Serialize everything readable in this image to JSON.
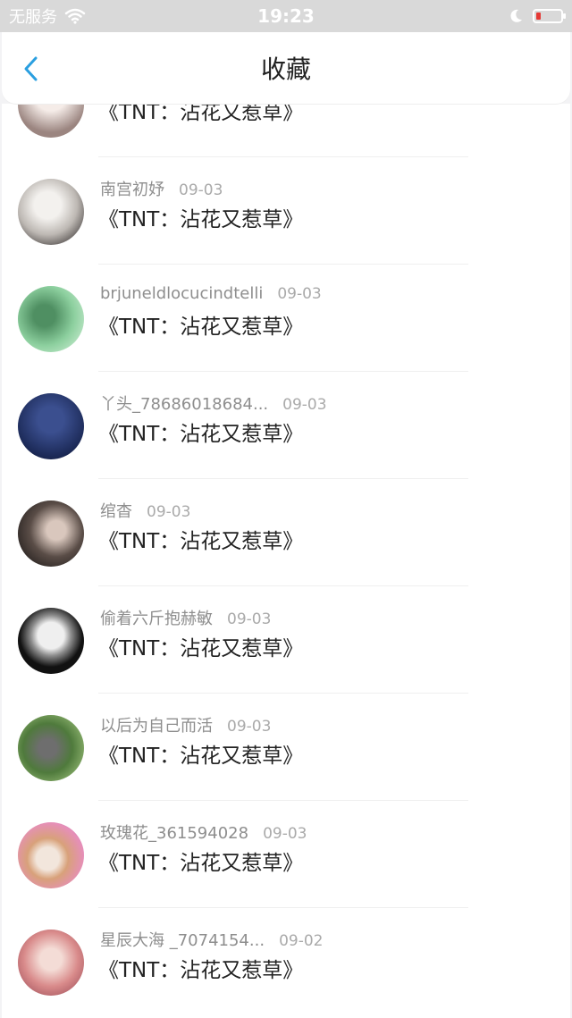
{
  "status_bar": {
    "carrier": "无服务",
    "time": "19:23"
  },
  "nav": {
    "title": "收藏"
  },
  "items": [
    {
      "name": "",
      "date": "",
      "title": "《TNT：沾花又惹草》",
      "avatar_color": "#d8d0cc"
    },
    {
      "name": "南宫初妤",
      "date": "09-03",
      "title": "《TNT：沾花又惹草》",
      "avatar_color": "#cfcfcf"
    },
    {
      "name": "brjuneldlocucindtelli",
      "date": "09-03",
      "title": "《TNT：沾花又惹草》",
      "avatar_color": "#7fbf8f"
    },
    {
      "name": "丫头_78686018684...",
      "date": "09-03",
      "title": "《TNT：沾花又惹草》",
      "avatar_color": "#1c2a58"
    },
    {
      "name": "绾杳",
      "date": "09-03",
      "title": "《TNT：沾花又惹草》",
      "avatar_color": "#3a3330"
    },
    {
      "name": "偷着六斤抱赫敏",
      "date": "09-03",
      "title": "《TNT：沾花又惹草》",
      "avatar_color": "#1a1a1a"
    },
    {
      "name": "以后为自己而活",
      "date": "09-03",
      "title": "《TNT：沾花又惹草》",
      "avatar_color": "#5d7a4a"
    },
    {
      "name": "玫瑰花_361594028",
      "date": "09-03",
      "title": "《TNT：沾花又惹草》",
      "avatar_color": "#e08fb0"
    },
    {
      "name": "星辰大海 _7074154...",
      "date": "09-02",
      "title": "《TNT：沾花又惹草》",
      "avatar_color": "#d98b8b"
    }
  ]
}
